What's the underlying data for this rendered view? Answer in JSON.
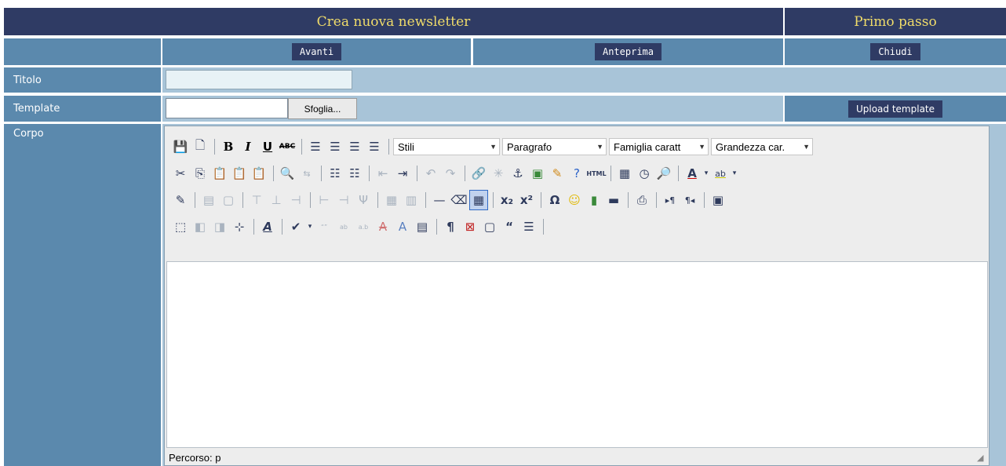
{
  "header": {
    "title": "Crea nuova newsletter",
    "step": "Primo passo"
  },
  "nav": {
    "next": "Avanti",
    "preview": "Anteprima",
    "close": "Chiudi"
  },
  "form": {
    "title_label": "Titolo",
    "title_value": "",
    "template_label": "Template",
    "browse_label": "Sfoglia...",
    "upload_label": "Upload template",
    "body_label": "Corpo"
  },
  "editor": {
    "styles_value": "Stili",
    "format_value": "Paragrafo",
    "font_family_value": "Famiglia caratt",
    "font_size_value": "Grandezza car.",
    "path_label": "Percorso: p",
    "html_button": "HTML"
  },
  "colors": {
    "header_bg": "#2f3b64",
    "header_text": "#f0dc6a",
    "row_blue": "#5b89ad",
    "row_light": "#a8c4d8"
  }
}
